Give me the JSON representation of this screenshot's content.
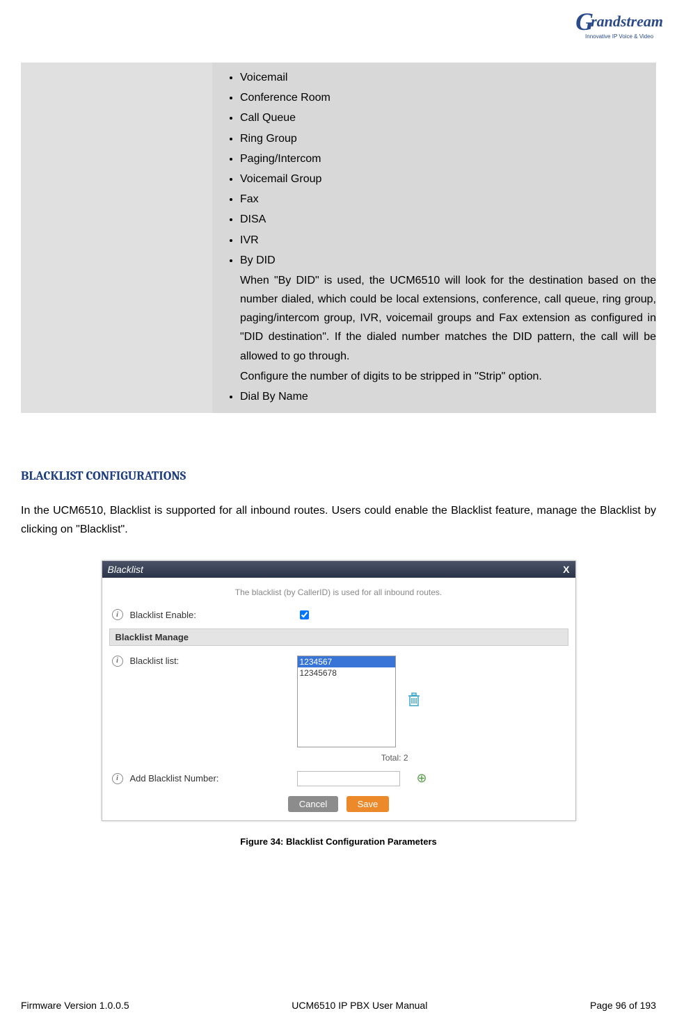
{
  "logo": {
    "brand": "Grandstream",
    "tag": "Innovative IP Voice & Video"
  },
  "bullets": {
    "items": [
      "Voicemail",
      "Conference Room",
      "Call Queue",
      "Ring Group",
      "Paging/Intercom",
      "Voicemail Group",
      "Fax",
      "DISA",
      "IVR",
      "By DID",
      "Dial By Name"
    ],
    "by_did_desc1": "When \"By DID\" is used, the UCM6510 will look for the destination based on the number dialed, which could be local extensions, conference, call queue, ring group, paging/intercom group, IVR, voicemail groups and Fax extension as configured in \"DID destination\". If the dialed number matches the DID pattern, the call will be allowed to go through.",
    "by_did_desc2": "Configure the number of digits to be stripped in \"Strip\" option."
  },
  "section_heading": "BLACKLIST CONFIGURATIONS",
  "body_para": "In the UCM6510, Blacklist is supported for all inbound routes. Users could enable the Blacklist feature, manage the Blacklist by clicking on \"Blacklist\".",
  "dialog": {
    "title": "Blacklist",
    "close": "X",
    "desc": "The blacklist (by CallerID) is used for all inbound routes.",
    "enable_label": "Blacklist Enable:",
    "manage_heading": "Blacklist Manage",
    "list_label": "Blacklist list:",
    "list_items": [
      "1234567",
      "12345678"
    ],
    "total_label": "Total: 2",
    "add_label": "Add Blacklist Number:",
    "cancel": "Cancel",
    "save": "Save"
  },
  "figure_caption": "Figure 34: Blacklist Configuration Parameters",
  "footer": {
    "left": "Firmware Version 1.0.0.5",
    "center": "UCM6510 IP PBX User Manual",
    "right": "Page 96 of 193"
  }
}
